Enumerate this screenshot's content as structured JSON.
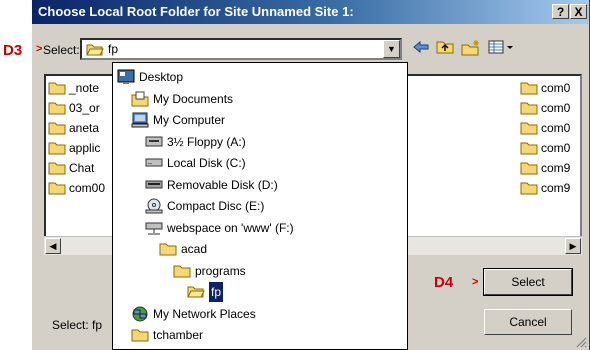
{
  "title": "Choose Local Root Folder for Site Unnamed Site 1:",
  "title_buttons": {
    "help": "?",
    "close": "X"
  },
  "annotations": {
    "d3": "D3",
    "d3_arrow": ">",
    "d4": "D4",
    "d4_arrow": ">"
  },
  "select_label": "Select:",
  "current_folder": "fp",
  "toolbar_icons": [
    "back-arrow-icon",
    "up-folder-icon",
    "new-folder-icon",
    "view-menu-icon"
  ],
  "left_files": [
    "_note",
    "03_or",
    "aneta",
    "applic",
    "Chat",
    "com00"
  ],
  "right_files": [
    "com0",
    "com0",
    "com0",
    "com0",
    "com9",
    "com9"
  ],
  "dropdown_items": [
    {
      "label": "Desktop",
      "icon": "desktop-icon",
      "indent": 0
    },
    {
      "label": "My Documents",
      "icon": "my-documents-icon",
      "indent": 1
    },
    {
      "label": "My Computer",
      "icon": "my-computer-icon",
      "indent": 1
    },
    {
      "label": "3½ Floppy (A:)",
      "icon": "floppy-drive-icon",
      "indent": 2
    },
    {
      "label": "Local Disk (C:)",
      "icon": "hard-disk-icon",
      "indent": 2
    },
    {
      "label": "Removable Disk (D:)",
      "icon": "removable-disk-icon",
      "indent": 2
    },
    {
      "label": "Compact Disc (E:)",
      "icon": "cd-drive-icon",
      "indent": 2
    },
    {
      "label": "webspace on 'www' (F:)",
      "icon": "network-drive-icon",
      "indent": 2
    },
    {
      "label": "acad",
      "icon": "folder-icon",
      "indent": 3
    },
    {
      "label": "programs",
      "icon": "folder-icon",
      "indent": 4
    },
    {
      "label": "fp",
      "icon": "open-folder-icon",
      "indent": 5,
      "selected": true
    },
    {
      "label": "My Network Places",
      "icon": "network-places-icon",
      "indent": 1
    },
    {
      "label": "tchamber",
      "icon": "folder-icon",
      "indent": 1
    }
  ],
  "bottom_select_label": "Select: fp",
  "buttons": {
    "select": "Select",
    "cancel": "Cancel"
  }
}
